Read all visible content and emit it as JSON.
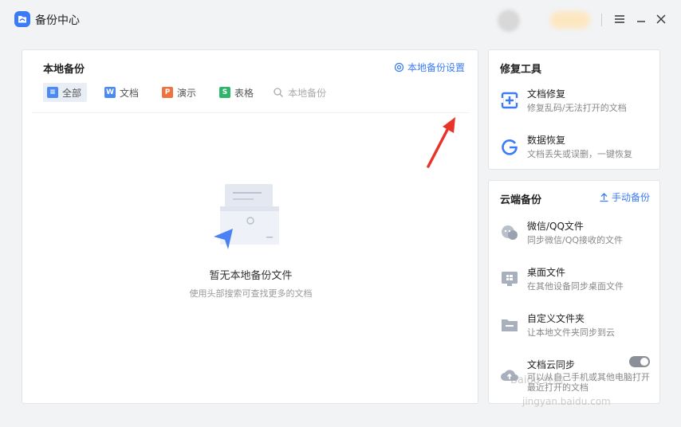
{
  "app": {
    "title": "备份中心"
  },
  "local": {
    "title": "本地备份",
    "settings_link": "本地备份设置",
    "tabs": [
      {
        "label": "全部",
        "icon": "list-icon",
        "color": "#4a8af4",
        "glyph": "≡"
      },
      {
        "label": "文档",
        "icon": "word-doc-icon",
        "color": "#4a8af4",
        "glyph": "W"
      },
      {
        "label": "演示",
        "icon": "presentation-icon",
        "color": "#f0733f",
        "glyph": "P"
      },
      {
        "label": "表格",
        "icon": "spreadsheet-icon",
        "color": "#2db56c",
        "glyph": "S"
      }
    ],
    "search_label": "本地备份",
    "empty_title": "暂无本地备份文件",
    "empty_subtitle": "使用头部搜索可查找更多的文档"
  },
  "repair": {
    "title": "修复工具",
    "items": [
      {
        "name": "文档修复",
        "desc": "修复乱码/无法打开的文档",
        "icon": "doc-repair-icon"
      },
      {
        "name": "数据恢复",
        "desc": "文档丢失或误删，一键恢复",
        "icon": "data-recovery-icon"
      }
    ]
  },
  "cloud": {
    "title": "云端备份",
    "manual_link": "手动备份",
    "items": [
      {
        "name": "微信/QQ文件",
        "desc": "同步微信/QQ接收的文件",
        "icon": "chat-icon"
      },
      {
        "name": "桌面文件",
        "desc": "在其他设备同步桌面文件",
        "icon": "desktop-icon"
      },
      {
        "name": "自定义文件夹",
        "desc": "让本地文件夹同步到云",
        "icon": "folder-icon"
      },
      {
        "name": "文档云同步",
        "desc": "可以从自己手机或其他电脑打开最近打开的文档",
        "icon": "cloud-upload-icon"
      }
    ],
    "sync_enabled": true
  },
  "colors": {
    "accent": "#3b7cf6",
    "annotation": "#e8332a"
  },
  "watermark": {
    "text": "Baidu 经验",
    "url": "jingyan.baidu.com"
  }
}
